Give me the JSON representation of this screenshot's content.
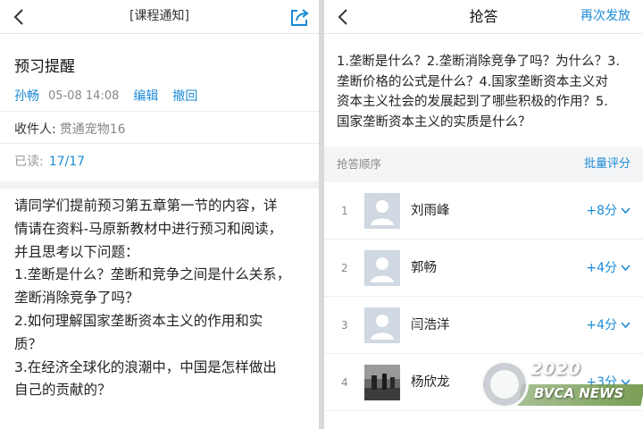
{
  "left": {
    "nav_title": "[课程通知]",
    "title": "预习提醒",
    "author": "孙畅",
    "time": "05-08 14:08",
    "edit_label": "编辑",
    "withdraw_label": "撤回",
    "recipient_label": "收件人:",
    "recipient": "贯通宠物16",
    "read_label": "已读:",
    "read_count": "17/17",
    "body": [
      "请同学们提前预习第五章第一节的内容，详",
      "情请在资料-马原新教材中进行预习和阅读，",
      "并且思考以下问题：",
      "1.垄断是什么？垄断和竞争之间是什么关系，",
      "垄断消除竞争了吗？",
      "2.如何理解国家垄断资本主义的作用和实",
      "质？",
      "3.在经济全球化的浪潮中，中国是怎样做出",
      "自己的贡献的？"
    ]
  },
  "right": {
    "nav_title": "抢答",
    "resend_label": "再次发放",
    "question_lines": [
      "1.垄断是什么？2.垄断消除竞争了吗？为什么？3.",
      "垄断价格的公式是什么？4.国家垄断资本主义对",
      "资本主义社会的发展起到了哪些积极的作用？5.",
      "国家垄断资本主义的实质是什么？"
    ],
    "order_label": "抢答顺序",
    "batch_label": "批量评分",
    "rows": [
      {
        "rank": "1",
        "name": "刘雨峰",
        "score": "+8分"
      },
      {
        "rank": "2",
        "name": "郭畅",
        "score": "+4分"
      },
      {
        "rank": "3",
        "name": "闫浩洋",
        "score": "+4分"
      },
      {
        "rank": "4",
        "name": "杨欣龙",
        "score": "+3分"
      }
    ]
  },
  "watermark": {
    "year": "2020",
    "brand": "BVCA NEWS"
  },
  "colors": {
    "accent": "#1b8bd6",
    "divider": "#d9d9d9"
  },
  "icons": {
    "back": "chevron-left-icon",
    "share": "share-icon",
    "expand": "chevron-down-icon",
    "avatar": "user-avatar-icon"
  }
}
